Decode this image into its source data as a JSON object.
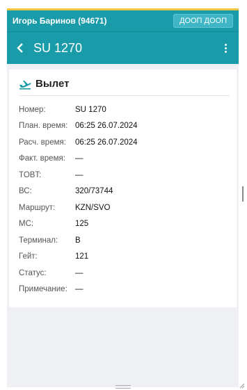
{
  "header": {
    "user_name": "Игорь Баринов (94671)",
    "user_button": "ДООП ДООП"
  },
  "nav": {
    "title": "SU 1270"
  },
  "section": {
    "title": "Вылет",
    "icon": "plane-departure-icon"
  },
  "details": [
    {
      "label": "Номер:",
      "value": "SU 1270"
    },
    {
      "label": "План. время:",
      "value": "06:25 26.07.2024"
    },
    {
      "label": "Расч. время:",
      "value": "06:25 26.07.2024"
    },
    {
      "label": "Факт. время:",
      "value": "—"
    },
    {
      "label": "TOBT:",
      "value": "—"
    },
    {
      "label": "ВС:",
      "value": "320/73744"
    },
    {
      "label": "Маршрут:",
      "value": "KZN/SVO"
    },
    {
      "label": "МС:",
      "value": "125"
    },
    {
      "label": "Терминал:",
      "value": "B"
    },
    {
      "label": "Гейт:",
      "value": "121"
    },
    {
      "label": "Статус:",
      "value": "—"
    },
    {
      "label": "Примечание:",
      "value": "—"
    }
  ],
  "colors": {
    "accent": "#1a9ba9",
    "top_strip": "#f5c542"
  }
}
